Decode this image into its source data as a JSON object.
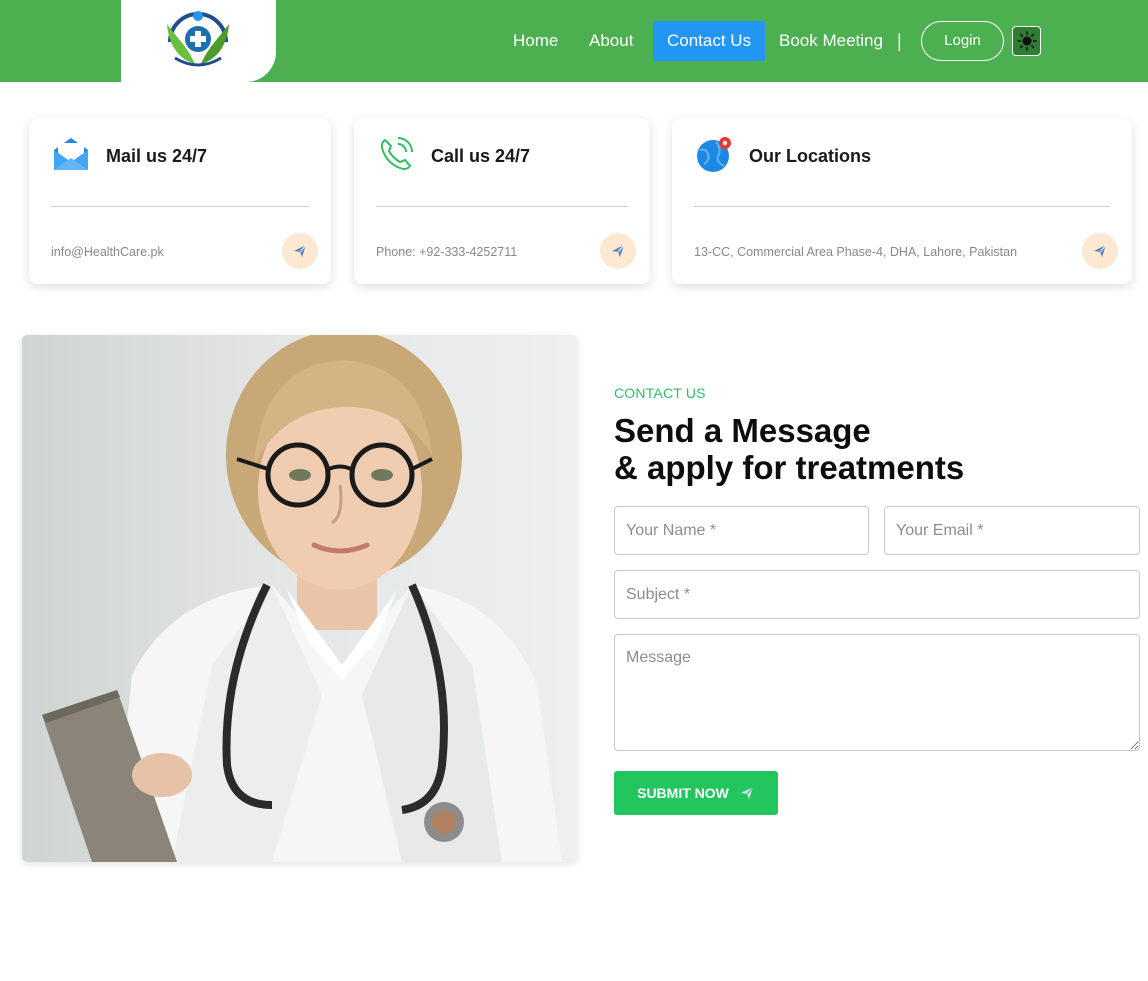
{
  "nav": {
    "logo_alt": "HealthCare logo",
    "links": [
      "Home",
      "About",
      "Contact Us",
      "Book Meeting"
    ],
    "active": "Contact Us",
    "separator": "|",
    "login": "Login",
    "theme_icon": "sun-icon"
  },
  "cards": [
    {
      "title": "Mail us 24/7",
      "text": "info@HealthCare.pk",
      "icon": "mail-icon"
    },
    {
      "title": "Call us 24/7",
      "text": "Phone: +92-333-4252711",
      "icon": "phone-icon"
    },
    {
      "title": "Our Locations",
      "text": "13-CC, Commercial Area Phase-4, DHA, Lahore, Pakistan",
      "icon": "globe-location-icon"
    }
  ],
  "contact": {
    "eyebrow": "CONTACT US",
    "heading_line1": "Send a Message",
    "heading_line2": "& apply for treatments",
    "name_placeholder": "Your Name *",
    "email_placeholder": "Your Email *",
    "subject_placeholder": "Subject *",
    "message_placeholder": "Message",
    "submit": "SUBMIT NOW"
  },
  "colors": {
    "nav_bg": "#4caf50",
    "active_link": "#2196f3",
    "accent_green": "#22c55e",
    "card_action_bg": "#fde9d2"
  }
}
